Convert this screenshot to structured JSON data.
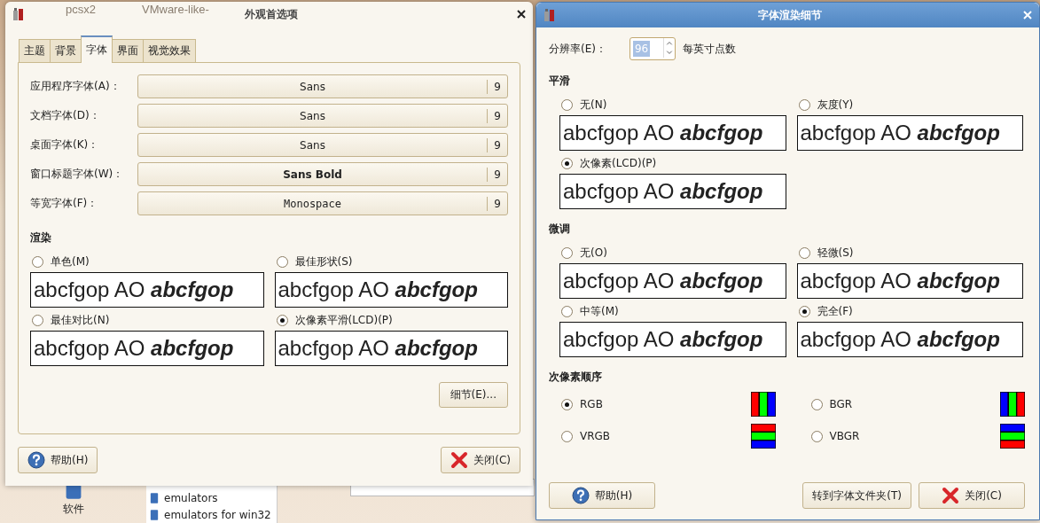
{
  "desktop": {
    "icons": [
      {
        "label": "pcsx2"
      },
      {
        "label": "VMware-like-"
      },
      {
        "label": "软件"
      }
    ],
    "file_list": [
      "emulators",
      "emulators for win32"
    ]
  },
  "appearance_window": {
    "title": "外观首选项",
    "tabs": [
      {
        "label": "主题",
        "selected": false
      },
      {
        "label": "背景",
        "selected": false
      },
      {
        "label": "字体",
        "selected": true
      },
      {
        "label": "界面",
        "selected": false
      },
      {
        "label": "视觉效果",
        "selected": false
      }
    ],
    "font_rows": [
      {
        "label": "应用程序字体(A)：",
        "font": "Sans",
        "size": "9",
        "kind": "sans"
      },
      {
        "label": "文档字体(D)：",
        "font": "Sans",
        "size": "9",
        "kind": "sans"
      },
      {
        "label": "桌面字体(K)：",
        "font": "Sans",
        "size": "9",
        "kind": "sans"
      },
      {
        "label": "窗口标题字体(W)：",
        "font": "Sans Bold",
        "size": "9",
        "kind": "bold"
      },
      {
        "label": "等宽字体(F)：",
        "font": "Monospace",
        "size": "9",
        "kind": "mono"
      }
    ],
    "rendering": {
      "title": "渲染",
      "options": [
        {
          "label": "单色(M)",
          "selected": false,
          "sample": "abcfgop AO *abcfgop*"
        },
        {
          "label": "最佳形状(S)",
          "selected": false,
          "sample": "abcfgop AO *abcfgop*"
        },
        {
          "label": "最佳对比(N)",
          "selected": false,
          "sample": "abcfgop AO *abcfgop*"
        },
        {
          "label": "次像素平滑(LCD)(P)",
          "selected": true,
          "sample": "abcfgop AO *abcfgop*"
        }
      ]
    },
    "details_button": "细节(E)...",
    "help_button": "帮助(H)",
    "close_button": "关闭(C)"
  },
  "details_window": {
    "title": "字体渲染细节",
    "resolution_label": "分辨率(E)：",
    "resolution_value": "96",
    "resolution_unit": "每英寸点数",
    "smoothing": {
      "title": "平滑",
      "options": [
        {
          "label": "无(N)",
          "selected": false,
          "sample": "abcfgop AO *abcfgop*"
        },
        {
          "label": "灰度(Y)",
          "selected": false,
          "sample": "abcfgop AO *abcfgop*"
        },
        {
          "label": "次像素(LCD)(P)",
          "selected": true,
          "sample": "abcfgop AO *abcfgop*"
        }
      ]
    },
    "hinting": {
      "title": "微调",
      "options": [
        {
          "label": "无(O)",
          "selected": false,
          "sample": "abcfgop AO *abcfgop*"
        },
        {
          "label": "轻微(S)",
          "selected": false,
          "sample": "abcfgop AO *abcfgop*"
        },
        {
          "label": "中等(M)",
          "selected": false,
          "sample": "abcfgop AO *abcfgop*"
        },
        {
          "label": "完全(F)",
          "selected": true,
          "sample": "abcfgop AO *abcfgop*"
        }
      ]
    },
    "subpixel_order": {
      "title": "次像素顺序",
      "options": [
        {
          "label": "RGB",
          "selected": true,
          "kind": "rgb"
        },
        {
          "label": "BGR",
          "selected": false,
          "kind": "bgr"
        },
        {
          "label": "VRGB",
          "selected": false,
          "kind": "vrgb"
        },
        {
          "label": "VBGR",
          "selected": false,
          "kind": "vbgr"
        }
      ]
    },
    "help_button": "帮助(H)",
    "fonts_folder_button": "转到字体文件夹(T)",
    "close_button": "关闭(C)"
  }
}
